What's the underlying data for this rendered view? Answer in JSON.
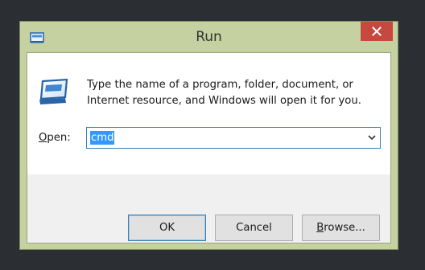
{
  "window": {
    "title": "Run"
  },
  "dialog": {
    "description": "Type the name of a program, folder, document, or Internet resource, and Windows will open it for you.",
    "open_label_accel": "O",
    "open_label_rest": "pen:",
    "open_value": "cmd"
  },
  "buttons": {
    "ok": "OK",
    "cancel": "Cancel",
    "browse_accel": "B",
    "browse_rest": "rowse..."
  },
  "icons": {
    "title": "run-icon",
    "close": "close-icon",
    "dialog": "run-icon",
    "dropdown": "chevron-down-icon"
  },
  "colors": {
    "frame": "#c5d1a0",
    "close_button": "#c7483e",
    "selection": "#3399ff",
    "focus_border": "#3c7fb1"
  }
}
